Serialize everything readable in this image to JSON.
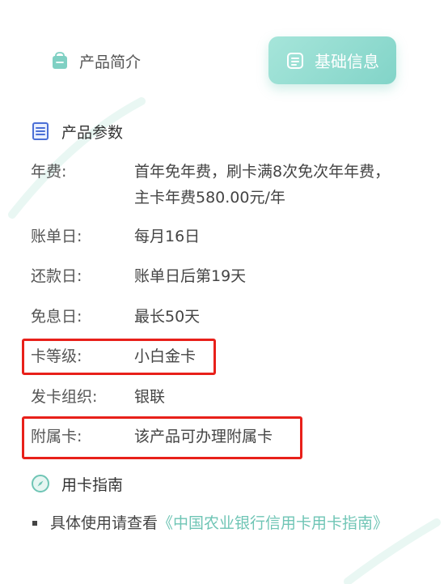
{
  "tabs": {
    "intro": {
      "label": "产品简介",
      "icon": "shopping-bag-icon"
    },
    "basic": {
      "label": "基础信息",
      "icon": "document-icon"
    }
  },
  "params_section": {
    "title": "产品参数",
    "icon": "list-icon"
  },
  "params": [
    {
      "label": "年费:",
      "value": "首年免年费，刷卡满8次免次年年费，主卡年费580.00元/年"
    },
    {
      "label": "账单日:",
      "value": "每月16日"
    },
    {
      "label": "还款日:",
      "value": "账单日后第19天"
    },
    {
      "label": "免息日:",
      "value": "最长50天"
    },
    {
      "label": "卡等级:",
      "value": "小白金卡"
    },
    {
      "label": "发卡组织:",
      "value": "银联"
    },
    {
      "label": "附属卡:",
      "value": "该产品可办理附属卡"
    }
  ],
  "guide_section": {
    "title": "用卡指南",
    "icon": "compass-icon"
  },
  "guide": {
    "prefix": "具体使用请查看",
    "link": "《中国农业银行信用卡用卡指南》"
  },
  "colors": {
    "accent": "#82d4c8",
    "link": "#6fc5b5",
    "highlight": "#e8201a"
  }
}
